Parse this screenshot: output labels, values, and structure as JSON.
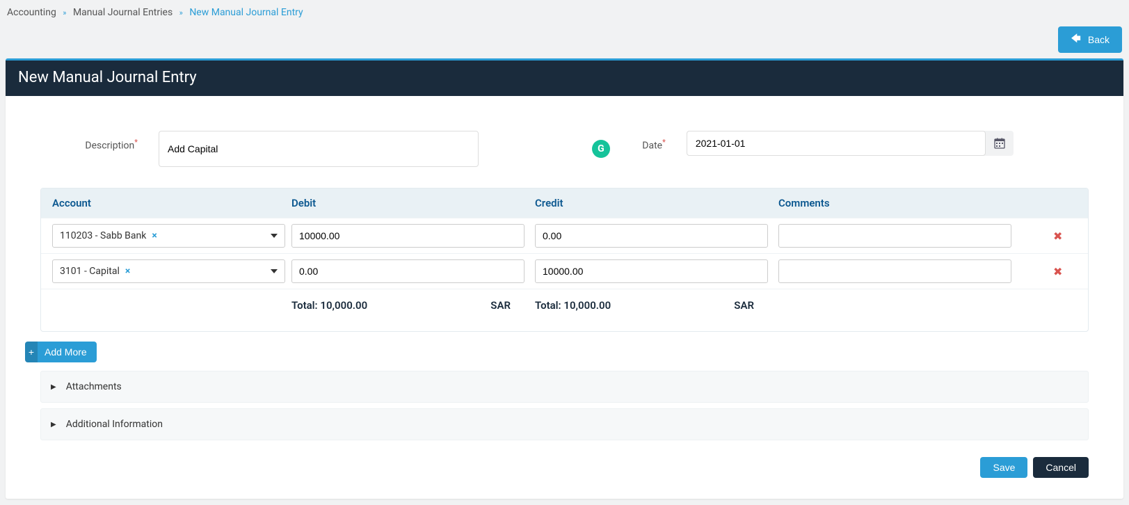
{
  "breadcrumb": {
    "item1": "Accounting",
    "item2": "Manual Journal Entries",
    "item3": "New Manual Journal Entry"
  },
  "buttons": {
    "back": "Back",
    "add_more": "Add More",
    "save": "Save",
    "cancel": "Cancel"
  },
  "header": {
    "title": "New Manual Journal Entry"
  },
  "form": {
    "description_label": "Description",
    "description_value": "Add Capital",
    "date_label": "Date",
    "date_value": "2021-01-01"
  },
  "grid": {
    "headers": {
      "account": "Account",
      "debit": "Debit",
      "credit": "Credit",
      "comments": "Comments"
    },
    "rows": [
      {
        "account": "110203 - Sabb Bank",
        "debit": "10000.00",
        "credit": "0.00",
        "comments": ""
      },
      {
        "account": "3101 - Capital",
        "debit": "0.00",
        "credit": "10000.00",
        "comments": ""
      }
    ],
    "totals": {
      "label": "Total:",
      "debit": "10,000.00",
      "credit": "10,000.00",
      "currency": "SAR"
    }
  },
  "collapses": {
    "attachments": "Attachments",
    "additional": "Additional Information"
  }
}
